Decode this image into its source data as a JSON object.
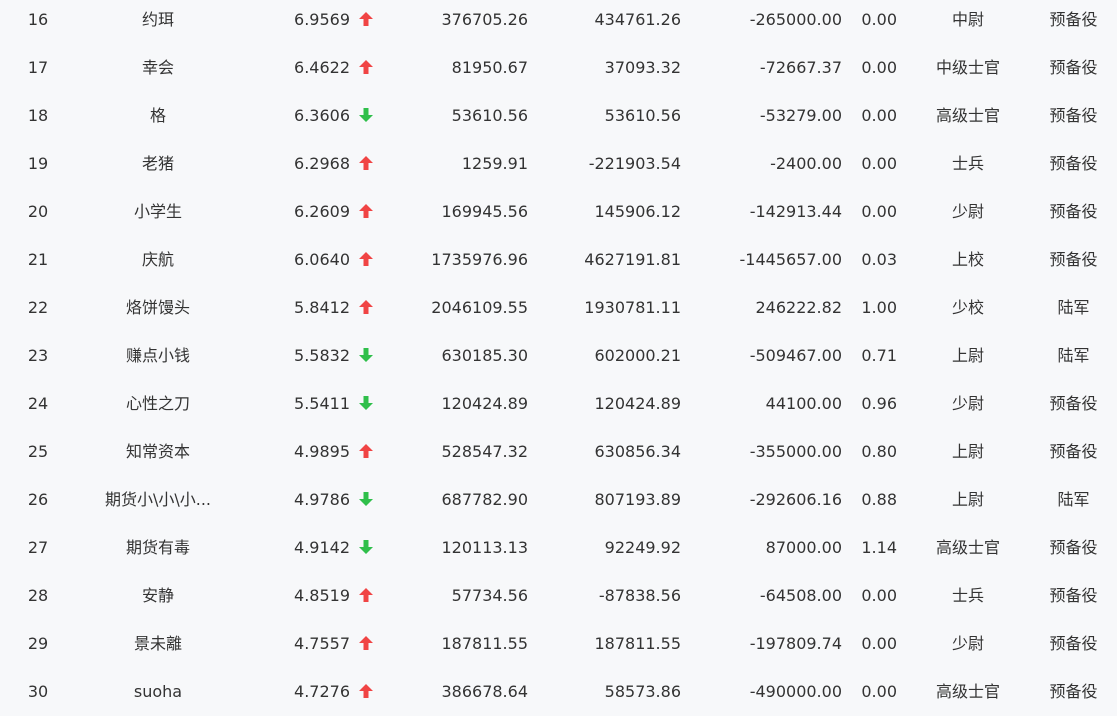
{
  "colors": {
    "up": "#f04444",
    "down": "#2fbf4a",
    "text": "#333333",
    "background": "#f7f8fa"
  },
  "rows": [
    {
      "rank": "16",
      "name": "约珥",
      "score": "6.9569",
      "trend": "up",
      "v1": "376705.26",
      "v2": "434761.26",
      "v3": "-265000.00",
      "ratio": "0.00",
      "title": "中尉",
      "branch": "预备役"
    },
    {
      "rank": "17",
      "name": "幸会",
      "score": "6.4622",
      "trend": "up",
      "v1": "81950.67",
      "v2": "37093.32",
      "v3": "-72667.37",
      "ratio": "0.00",
      "title": "中级士官",
      "branch": "预备役"
    },
    {
      "rank": "18",
      "name": "格",
      "score": "6.3606",
      "trend": "down",
      "v1": "53610.56",
      "v2": "53610.56",
      "v3": "-53279.00",
      "ratio": "0.00",
      "title": "高级士官",
      "branch": "预备役"
    },
    {
      "rank": "19",
      "name": "老猪",
      "score": "6.2968",
      "trend": "up",
      "v1": "1259.91",
      "v2": "-221903.54",
      "v3": "-2400.00",
      "ratio": "0.00",
      "title": "士兵",
      "branch": "预备役"
    },
    {
      "rank": "20",
      "name": "小学生",
      "score": "6.2609",
      "trend": "up",
      "v1": "169945.56",
      "v2": "145906.12",
      "v3": "-142913.44",
      "ratio": "0.00",
      "title": "少尉",
      "branch": "预备役"
    },
    {
      "rank": "21",
      "name": "庆航",
      "score": "6.0640",
      "trend": "up",
      "v1": "1735976.96",
      "v2": "4627191.81",
      "v3": "-1445657.00",
      "ratio": "0.03",
      "title": "上校",
      "branch": "预备役"
    },
    {
      "rank": "22",
      "name": "烙饼馒头",
      "score": "5.8412",
      "trend": "up",
      "v1": "2046109.55",
      "v2": "1930781.11",
      "v3": "246222.82",
      "ratio": "1.00",
      "title": "少校",
      "branch": "陆军"
    },
    {
      "rank": "23",
      "name": "赚点小钱",
      "score": "5.5832",
      "trend": "down",
      "v1": "630185.30",
      "v2": "602000.21",
      "v3": "-509467.00",
      "ratio": "0.71",
      "title": "上尉",
      "branch": "陆军"
    },
    {
      "rank": "24",
      "name": "心性之刀",
      "score": "5.5411",
      "trend": "down",
      "v1": "120424.89",
      "v2": "120424.89",
      "v3": "44100.00",
      "ratio": "0.96",
      "title": "少尉",
      "branch": "预备役"
    },
    {
      "rank": "25",
      "name": "知常资本",
      "score": "4.9895",
      "trend": "up",
      "v1": "528547.32",
      "v2": "630856.34",
      "v3": "-355000.00",
      "ratio": "0.80",
      "title": "上尉",
      "branch": "预备役"
    },
    {
      "rank": "26",
      "name": "期货小\\小\\小...",
      "score": "4.9786",
      "trend": "down",
      "v1": "687782.90",
      "v2": "807193.89",
      "v3": "-292606.16",
      "ratio": "0.88",
      "title": "上尉",
      "branch": "陆军"
    },
    {
      "rank": "27",
      "name": "期货有毒",
      "score": "4.9142",
      "trend": "down",
      "v1": "120113.13",
      "v2": "92249.92",
      "v3": "87000.00",
      "ratio": "1.14",
      "title": "高级士官",
      "branch": "预备役"
    },
    {
      "rank": "28",
      "name": "安静",
      "score": "4.8519",
      "trend": "up",
      "v1": "57734.56",
      "v2": "-87838.56",
      "v3": "-64508.00",
      "ratio": "0.00",
      "title": "士兵",
      "branch": "预备役"
    },
    {
      "rank": "29",
      "name": "景未離",
      "score": "4.7557",
      "trend": "up",
      "v1": "187811.55",
      "v2": "187811.55",
      "v3": "-197809.74",
      "ratio": "0.00",
      "title": "少尉",
      "branch": "预备役"
    },
    {
      "rank": "30",
      "name": "suoha",
      "score": "4.7276",
      "trend": "up",
      "v1": "386678.64",
      "v2": "58573.86",
      "v3": "-490000.00",
      "ratio": "0.00",
      "title": "高级士官",
      "branch": "预备役"
    }
  ]
}
